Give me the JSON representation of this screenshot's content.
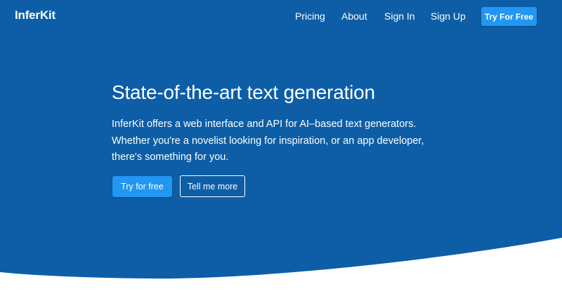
{
  "colors": {
    "hero_background": "#0d5ea6",
    "accent": "#2196f3",
    "text": "#ffffff",
    "page_background": "#ffffff"
  },
  "navbar": {
    "brand": "InferKit",
    "links": [
      "Pricing",
      "About",
      "Sign In",
      "Sign Up"
    ],
    "cta_label": "Try For Free"
  },
  "hero": {
    "title": "State-of-the-art text generation",
    "description_lines": [
      "InferKit offers a web interface and API for AI–based text generators.",
      "Whether you're a novelist looking for inspiration, or an app developer,",
      "there's something for you."
    ],
    "primary_button": "Try for free",
    "secondary_button": "Tell me more"
  }
}
